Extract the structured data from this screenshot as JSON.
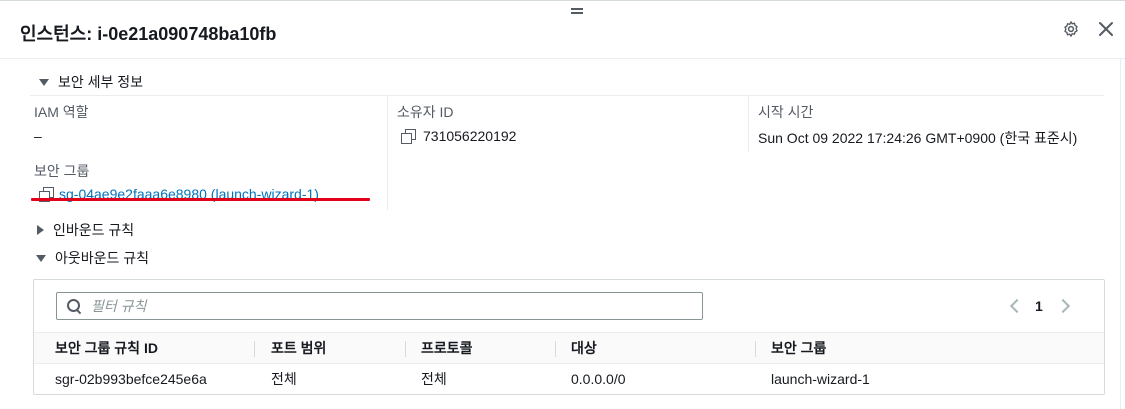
{
  "panel": {
    "title": "인스턴스: i-0e21a090748ba10fb",
    "settings_icon": "gear-icon",
    "close_icon": "close-icon"
  },
  "security_details": {
    "section_title": "보안 세부 정보",
    "iam_role_label": "IAM 역할",
    "iam_role_value": "–",
    "owner_id_label": "소유자 ID",
    "owner_id_value": "731056220192",
    "launch_time_label": "시작 시간",
    "launch_time_value": "Sun Oct 09 2022 17:24:26 GMT+0900 (한국 표준시)",
    "security_groups_label": "보안 그룹",
    "security_group_link": "sg-04ae9e2faaa6e8980 (launch-wizard-1)",
    "highlight_color": "#e2001a"
  },
  "inbound_rules": {
    "section_title": "인바운드 규칙"
  },
  "outbound_rules": {
    "section_title": "아웃바운드 규칙",
    "filter_placeholder": "필터 규칙",
    "pagination": {
      "current_page": "1"
    },
    "columns": [
      "보안 그룹 규칙 ID",
      "포트 범위",
      "프로토콜",
      "대상",
      "보안 그룹"
    ],
    "rows": [
      [
        "sgr-02b993befce245e6a",
        "전체",
        "전체",
        "0.0.0.0/0",
        "launch-wizard-1"
      ]
    ]
  },
  "colors": {
    "link": "#0073bb",
    "text": "#16191f",
    "muted": "#545b64",
    "border": "#d5dbdb"
  }
}
